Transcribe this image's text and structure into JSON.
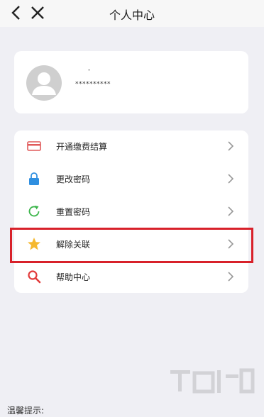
{
  "nav": {
    "title": "个人中心",
    "back_icon": "chevron-left-icon",
    "close_icon": "close-icon"
  },
  "profile": {
    "nickname": "-",
    "account": "**********"
  },
  "menu": {
    "items": [
      {
        "label": "开通缴费结算",
        "icon": "card-icon"
      },
      {
        "label": "更改密码",
        "icon": "lock-icon"
      },
      {
        "label": "重置密码",
        "icon": "refresh-icon"
      },
      {
        "label": "解除关联",
        "icon": "star-icon"
      },
      {
        "label": "帮助中心",
        "icon": "search-icon"
      }
    ]
  },
  "tip": {
    "text": "温馨提示:"
  },
  "colors": {
    "highlight": "#d8212a",
    "card_icon": "#e05a5a",
    "lock_icon": "#2f8fe0",
    "refresh_icon": "#3bb54a",
    "star_icon": "#f5b82e",
    "search_icon": "#e23b3b"
  }
}
